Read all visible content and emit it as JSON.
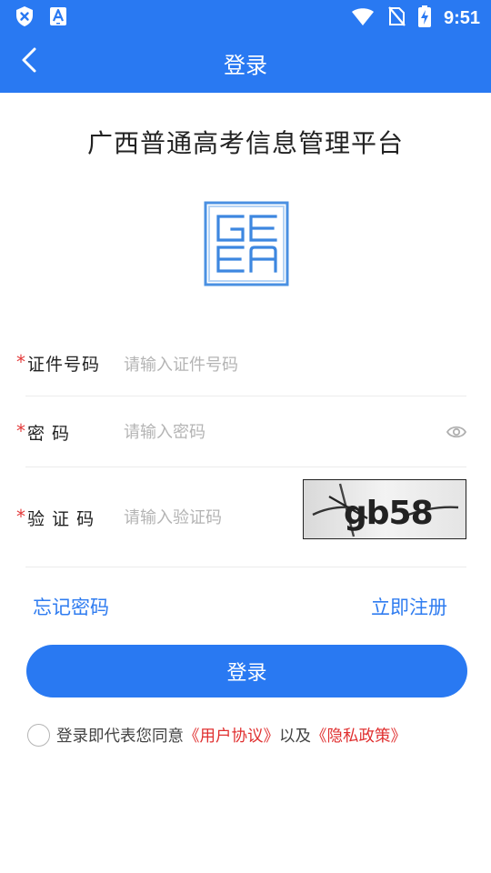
{
  "status_bar": {
    "time": "9:51",
    "left_icons": [
      "shield-x-icon",
      "text-a-icon"
    ],
    "right_icons": [
      "wifi-icon",
      "no-sim-icon",
      "battery-charging-icon"
    ]
  },
  "app_bar": {
    "title": "登录",
    "back_icon": "chevron-left-icon"
  },
  "header": {
    "title": "广西普通高考信息管理平台",
    "logo_letters": "GEEA"
  },
  "form": {
    "id_number": {
      "required_mark": "*",
      "label": "证件号码",
      "placeholder": "请输入证件号码",
      "value": ""
    },
    "password": {
      "required_mark": "*",
      "label": "密 码",
      "placeholder": "请输入密码",
      "value": ""
    },
    "captcha": {
      "required_mark": "*",
      "label": "验 证 码",
      "placeholder": "请输入验证码",
      "value": "",
      "captcha_text": "gb58"
    }
  },
  "links": {
    "forgot_password": "忘记密码",
    "register": "立即注册"
  },
  "login_button": "登录",
  "agreement": {
    "prefix": "登录即代表您同意",
    "user_agreement": "《用户协议》",
    "middle": "以及",
    "privacy_policy": "《隐私政策》",
    "checked": false
  },
  "colors": {
    "primary": "#2979f2",
    "link": "#2f7cf0",
    "required": "#e33a3a",
    "agreement_link": "#e03030"
  }
}
